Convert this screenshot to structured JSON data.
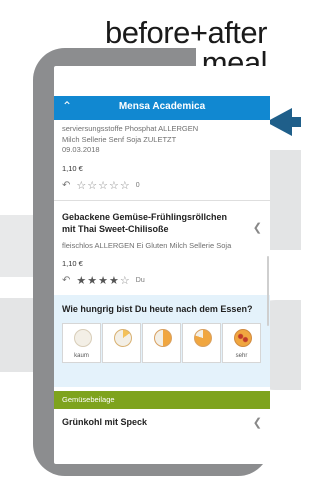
{
  "caption": {
    "line1": "before+after",
    "line2": "meal"
  },
  "app": {
    "title": "Mensa Academica",
    "back_icon": "chevron-up-icon"
  },
  "meal1": {
    "allergens_top": "serviersungsstoffe  Phosphat  ALLERGEN",
    "allergens_mid": "Milch  Sellerie  Senf  Soja  ZULETZT",
    "allergens_date": "09.03.2018",
    "price": "1,10 €",
    "rating_count": "0",
    "stars_filled": 0
  },
  "meal2": {
    "title": "Gebackene Gemüse-Frühlingsröllchen mit Thai Sweet-Chilisoße",
    "allergens": "fleischlos  ALLERGEN  Ei  Gluten  Milch  Sellerie  Soja",
    "price": "1,10 €",
    "rating_label": "Du",
    "stars_filled": 4
  },
  "hunger": {
    "question": "Wie hungrig bist Du heute nach dem Essen?",
    "options": [
      {
        "label": "kaum"
      },
      {
        "label": ""
      },
      {
        "label": ""
      },
      {
        "label": ""
      },
      {
        "label": "sehr"
      }
    ]
  },
  "section": {
    "label": "Gemüsebeilage"
  },
  "meal3": {
    "title": "Grünkohl mit Speck"
  },
  "colors": {
    "accent": "#1188d1",
    "section": "#7ea31d",
    "hunger_bg": "#e4f2fb",
    "arrow": "#1f5f8a"
  }
}
